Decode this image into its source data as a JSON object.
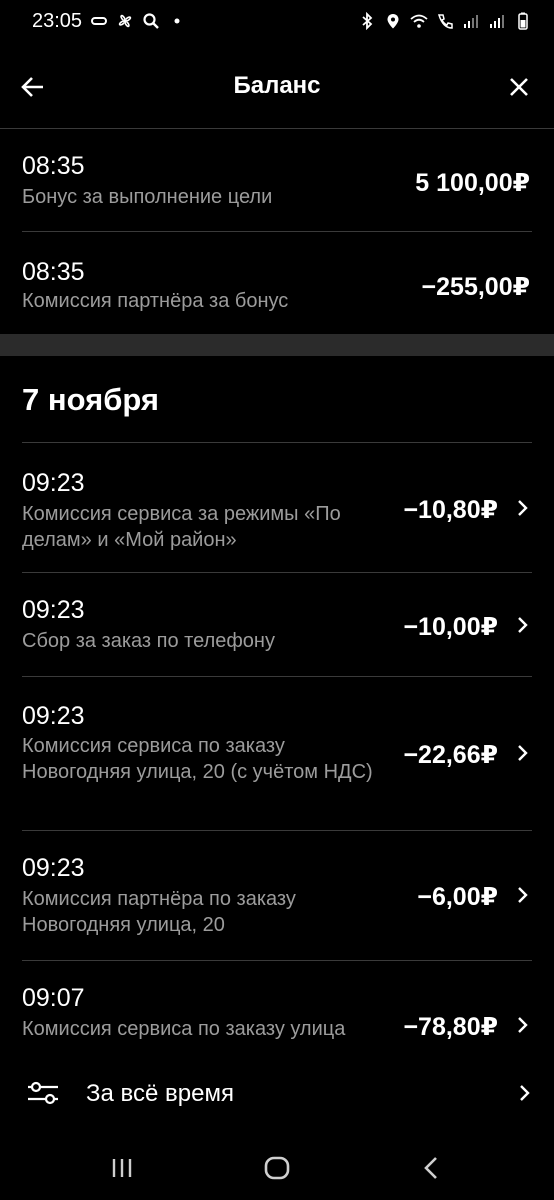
{
  "status_bar": {
    "time": "23:05"
  },
  "header": {
    "title": "Баланс"
  },
  "top_rows": [
    {
      "time": "08:35",
      "description": "Бонус за выполнение цели",
      "amount": "5 100,00₽"
    },
    {
      "time": "08:35",
      "description": "Комиссия партнёра за бонус",
      "amount": "−255,00₽"
    }
  ],
  "section": {
    "date": "7 ноября"
  },
  "rows": [
    {
      "time": "09:23",
      "description": "Комиссия сервиса за режимы «По делам» и «Мой район»",
      "amount": "−10,80₽"
    },
    {
      "time": "09:23",
      "description": "Сбор за заказ по телефону",
      "amount": "−10,00₽"
    },
    {
      "time": "09:23",
      "description": "Комиссия сервиса по заказу Новогодняя улица, 20 (с учётом НДС)",
      "amount": "−22,66₽"
    },
    {
      "time": "09:23",
      "description": "Комиссия партнёра по заказу Новогодняя улица, 20",
      "amount": "−6,00₽"
    },
    {
      "time": "09:07",
      "description": "Комиссия сервиса по заказу улица",
      "amount": "−78,80₽"
    }
  ],
  "filter": {
    "label": "За всё время"
  },
  "icons": {
    "back": "arrow-left-icon",
    "close": "close-icon",
    "chevron": "chevron-right-icon",
    "filter": "sliders-icon"
  },
  "colors": {
    "background": "#000000",
    "text_primary": "#ffffff",
    "text_secondary": "#9c9c9c",
    "divider": "#3a3a3a",
    "section_gap": "#2b2b2b"
  }
}
